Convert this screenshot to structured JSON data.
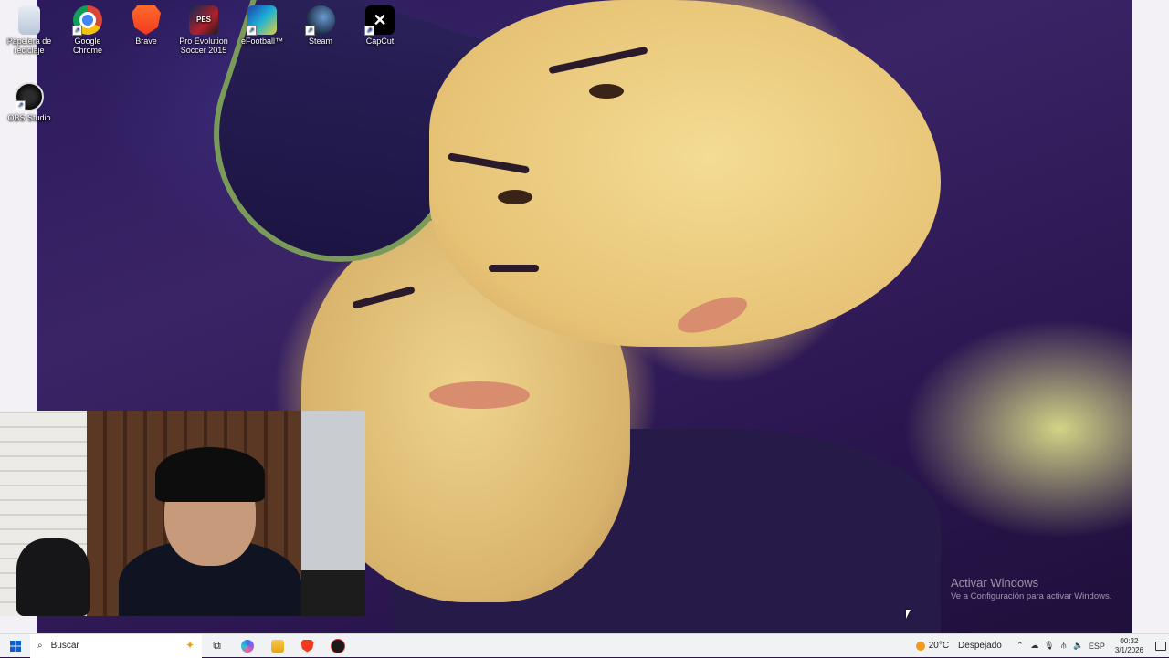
{
  "desktop": {
    "icons": [
      {
        "label": "Papelera de reciclaje",
        "icon": "recycle-bin-icon"
      },
      {
        "label": "Google Chrome",
        "icon": "chrome-icon"
      },
      {
        "label": "Brave",
        "icon": "brave-icon"
      },
      {
        "label": "Pro Evolution Soccer 2015",
        "icon": "pes-2015-icon"
      },
      {
        "label": "eFootball™",
        "icon": "efootball-icon"
      },
      {
        "label": "Steam",
        "icon": "steam-icon"
      },
      {
        "label": "CapCut",
        "icon": "capcut-icon"
      },
      {
        "label": "OBS Studio",
        "icon": "obs-studio-icon"
      }
    ],
    "pes_badge": "PES"
  },
  "watermark": {
    "title": "Activar Windows",
    "subtitle": "Ve a Configuración para activar Windows."
  },
  "taskbar": {
    "search_placeholder": "Buscar",
    "pinned": [
      "task-view-icon",
      "copilot-icon",
      "file-explorer-icon",
      "brave-icon",
      "obs-studio-icon"
    ],
    "weather": {
      "temp": "20°C",
      "condition": "Despejado"
    },
    "language": "ESP",
    "time": "00:32",
    "date": "3/1/2026",
    "colors": {
      "start_blue": "#0a5fd0",
      "brave_orange": "#f23a1e"
    }
  }
}
